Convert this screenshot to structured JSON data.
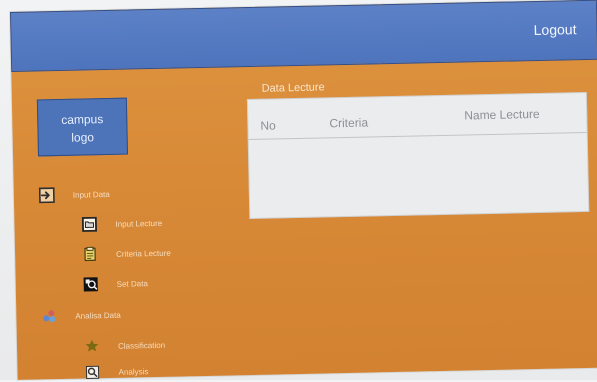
{
  "header": {
    "logout_label": "Logout"
  },
  "sidebar": {
    "logo_text": "campus\nlogo",
    "items": [
      {
        "label": "Input Data",
        "icon": "input-icon"
      },
      {
        "label": "Input Lecture",
        "icon": "folder-icon"
      },
      {
        "label": "Criteria Lecture",
        "icon": "clipboard-icon"
      },
      {
        "label": "Set Data",
        "icon": "search-icon"
      },
      {
        "label": "Analisa Data",
        "icon": "analysis-icon"
      },
      {
        "label": "Classification",
        "icon": "star-icon"
      },
      {
        "label": "Analysis",
        "icon": "magnifier-icon"
      }
    ]
  },
  "main": {
    "title": "Data Lecture",
    "table": {
      "columns": [
        "No",
        "Criteria",
        "Name Lecture"
      ]
    }
  },
  "colors": {
    "header_blue": "#5c81c7",
    "sidebar_orange": "#de9440",
    "logo_blue": "#4d73b8"
  }
}
